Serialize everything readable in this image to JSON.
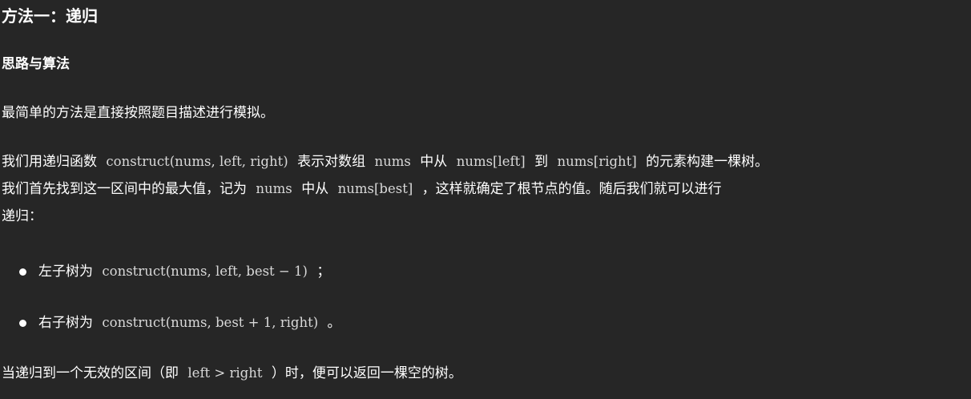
{
  "heading": "方法一：递归",
  "subheading": "思路与算法",
  "para1": "最简单的方法是直接按照题目描述进行模拟。",
  "para2": {
    "t1": "我们用递归函数",
    "m1": "construct(nums, left, right)",
    "t2": "表示对数组",
    "m2": "nums",
    "t3": "中从",
    "m3": "nums[left]",
    "t4": "到",
    "m4": "nums[right]",
    "t5": "的元素构建一棵树。",
    "t6": "我们首先找到这一区间中的最大值，记为",
    "m5": "nums",
    "t7": "中从",
    "m6": "nums[best]",
    "t8": "，这样就确定了根节点的值。随后我们就可以进行",
    "t9": "递归："
  },
  "list": [
    {
      "prefix": "左子树为",
      "math": "construct(nums, left, best − 1)",
      "suffix": "；"
    },
    {
      "prefix": "右子树为",
      "math": "construct(nums, best + 1, right)",
      "suffix": "。"
    }
  ],
  "para3": {
    "t1": "当递归到一个无效的区间（即",
    "m1": "left > right",
    "t2": "）时，便可以返回一棵空的树。"
  }
}
